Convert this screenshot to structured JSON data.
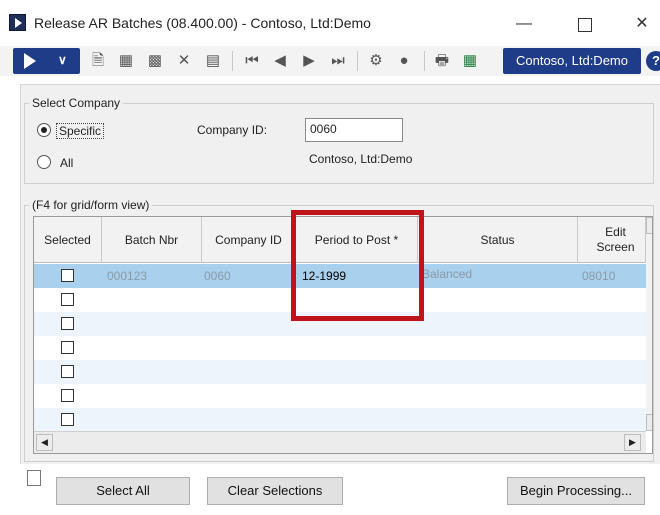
{
  "window": {
    "title": "Release AR Batches (08.400.00) - Contoso, Ltd:Demo",
    "minimize": "—",
    "close": "✕"
  },
  "toolbar": {
    "company_button": "Contoso, Ltd:Demo",
    "help": "?"
  },
  "select_company": {
    "group_label": "Select Company",
    "option_specific": "Specific",
    "option_all": "All",
    "selected_option": "Specific",
    "company_id_label": "Company ID:",
    "company_id_value": "0060",
    "company_name": "Contoso, Ltd:Demo"
  },
  "grid": {
    "group_label": "(F4 for grid/form view)",
    "columns": [
      "Selected",
      "Batch Nbr",
      "Company ID",
      "Period to Post *",
      "Status",
      "Edit",
      "Screen"
    ],
    "rows": [
      {
        "batch_nbr": "000123",
        "company_id": "0060",
        "period": "12-1999",
        "status": "Balanced",
        "edit_screen": "08010",
        "selected": false
      }
    ],
    "empty_rows": 6
  },
  "buttons": {
    "select_all": "Select All",
    "clear_selections": "Clear Selections",
    "begin_processing": "Begin Processing..."
  },
  "colors": {
    "brand_blue": "#1f3c88",
    "selected_row": "#a9d1ee",
    "highlight_box": "#c0141c"
  }
}
